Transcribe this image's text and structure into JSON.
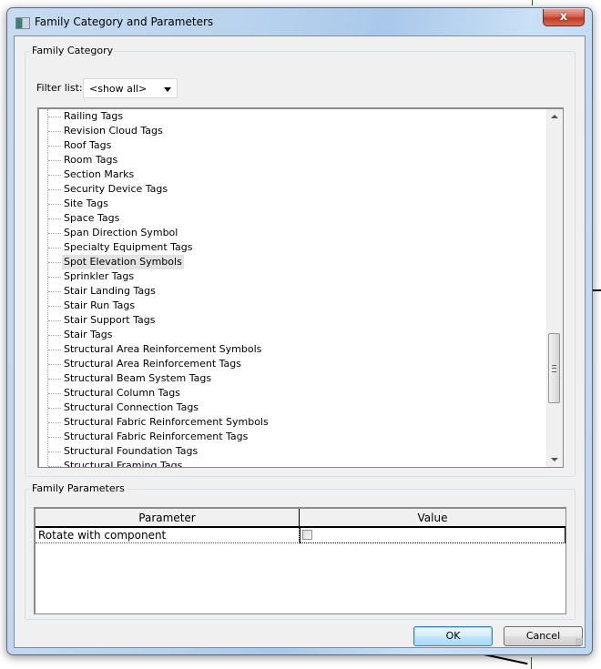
{
  "window": {
    "title": "Family Category and Parameters",
    "close_label": "x"
  },
  "family_category": {
    "legend": "Family Category",
    "filter_label": "Filter list:",
    "filter_value": "<show all>",
    "selected_item": "Spot Elevation Symbols",
    "items": [
      "Railing Tags",
      "Revision Cloud Tags",
      "Roof Tags",
      "Room Tags",
      "Section Marks",
      "Security Device Tags",
      "Site Tags",
      "Space Tags",
      "Span Direction Symbol",
      "Specialty Equipment Tags",
      "Spot Elevation Symbols",
      "Sprinkler Tags",
      "Stair Landing Tags",
      "Stair Run Tags",
      "Stair Support Tags",
      "Stair Tags",
      "Structural Area Reinforcement Symbols",
      "Structural Area Reinforcement Tags",
      "Structural Beam System Tags",
      "Structural Column Tags",
      "Structural Connection Tags",
      "Structural Fabric Reinforcement Symbols",
      "Structural Fabric Reinforcement Tags",
      "Structural Foundation Tags",
      "Structural Framing Tags"
    ]
  },
  "family_parameters": {
    "legend": "Family Parameters",
    "columns": [
      "Parameter",
      "Value"
    ],
    "rows": [
      {
        "parameter": "Rotate with component",
        "value_checked": false
      }
    ]
  },
  "buttons": {
    "ok": "OK",
    "cancel": "Cancel"
  }
}
